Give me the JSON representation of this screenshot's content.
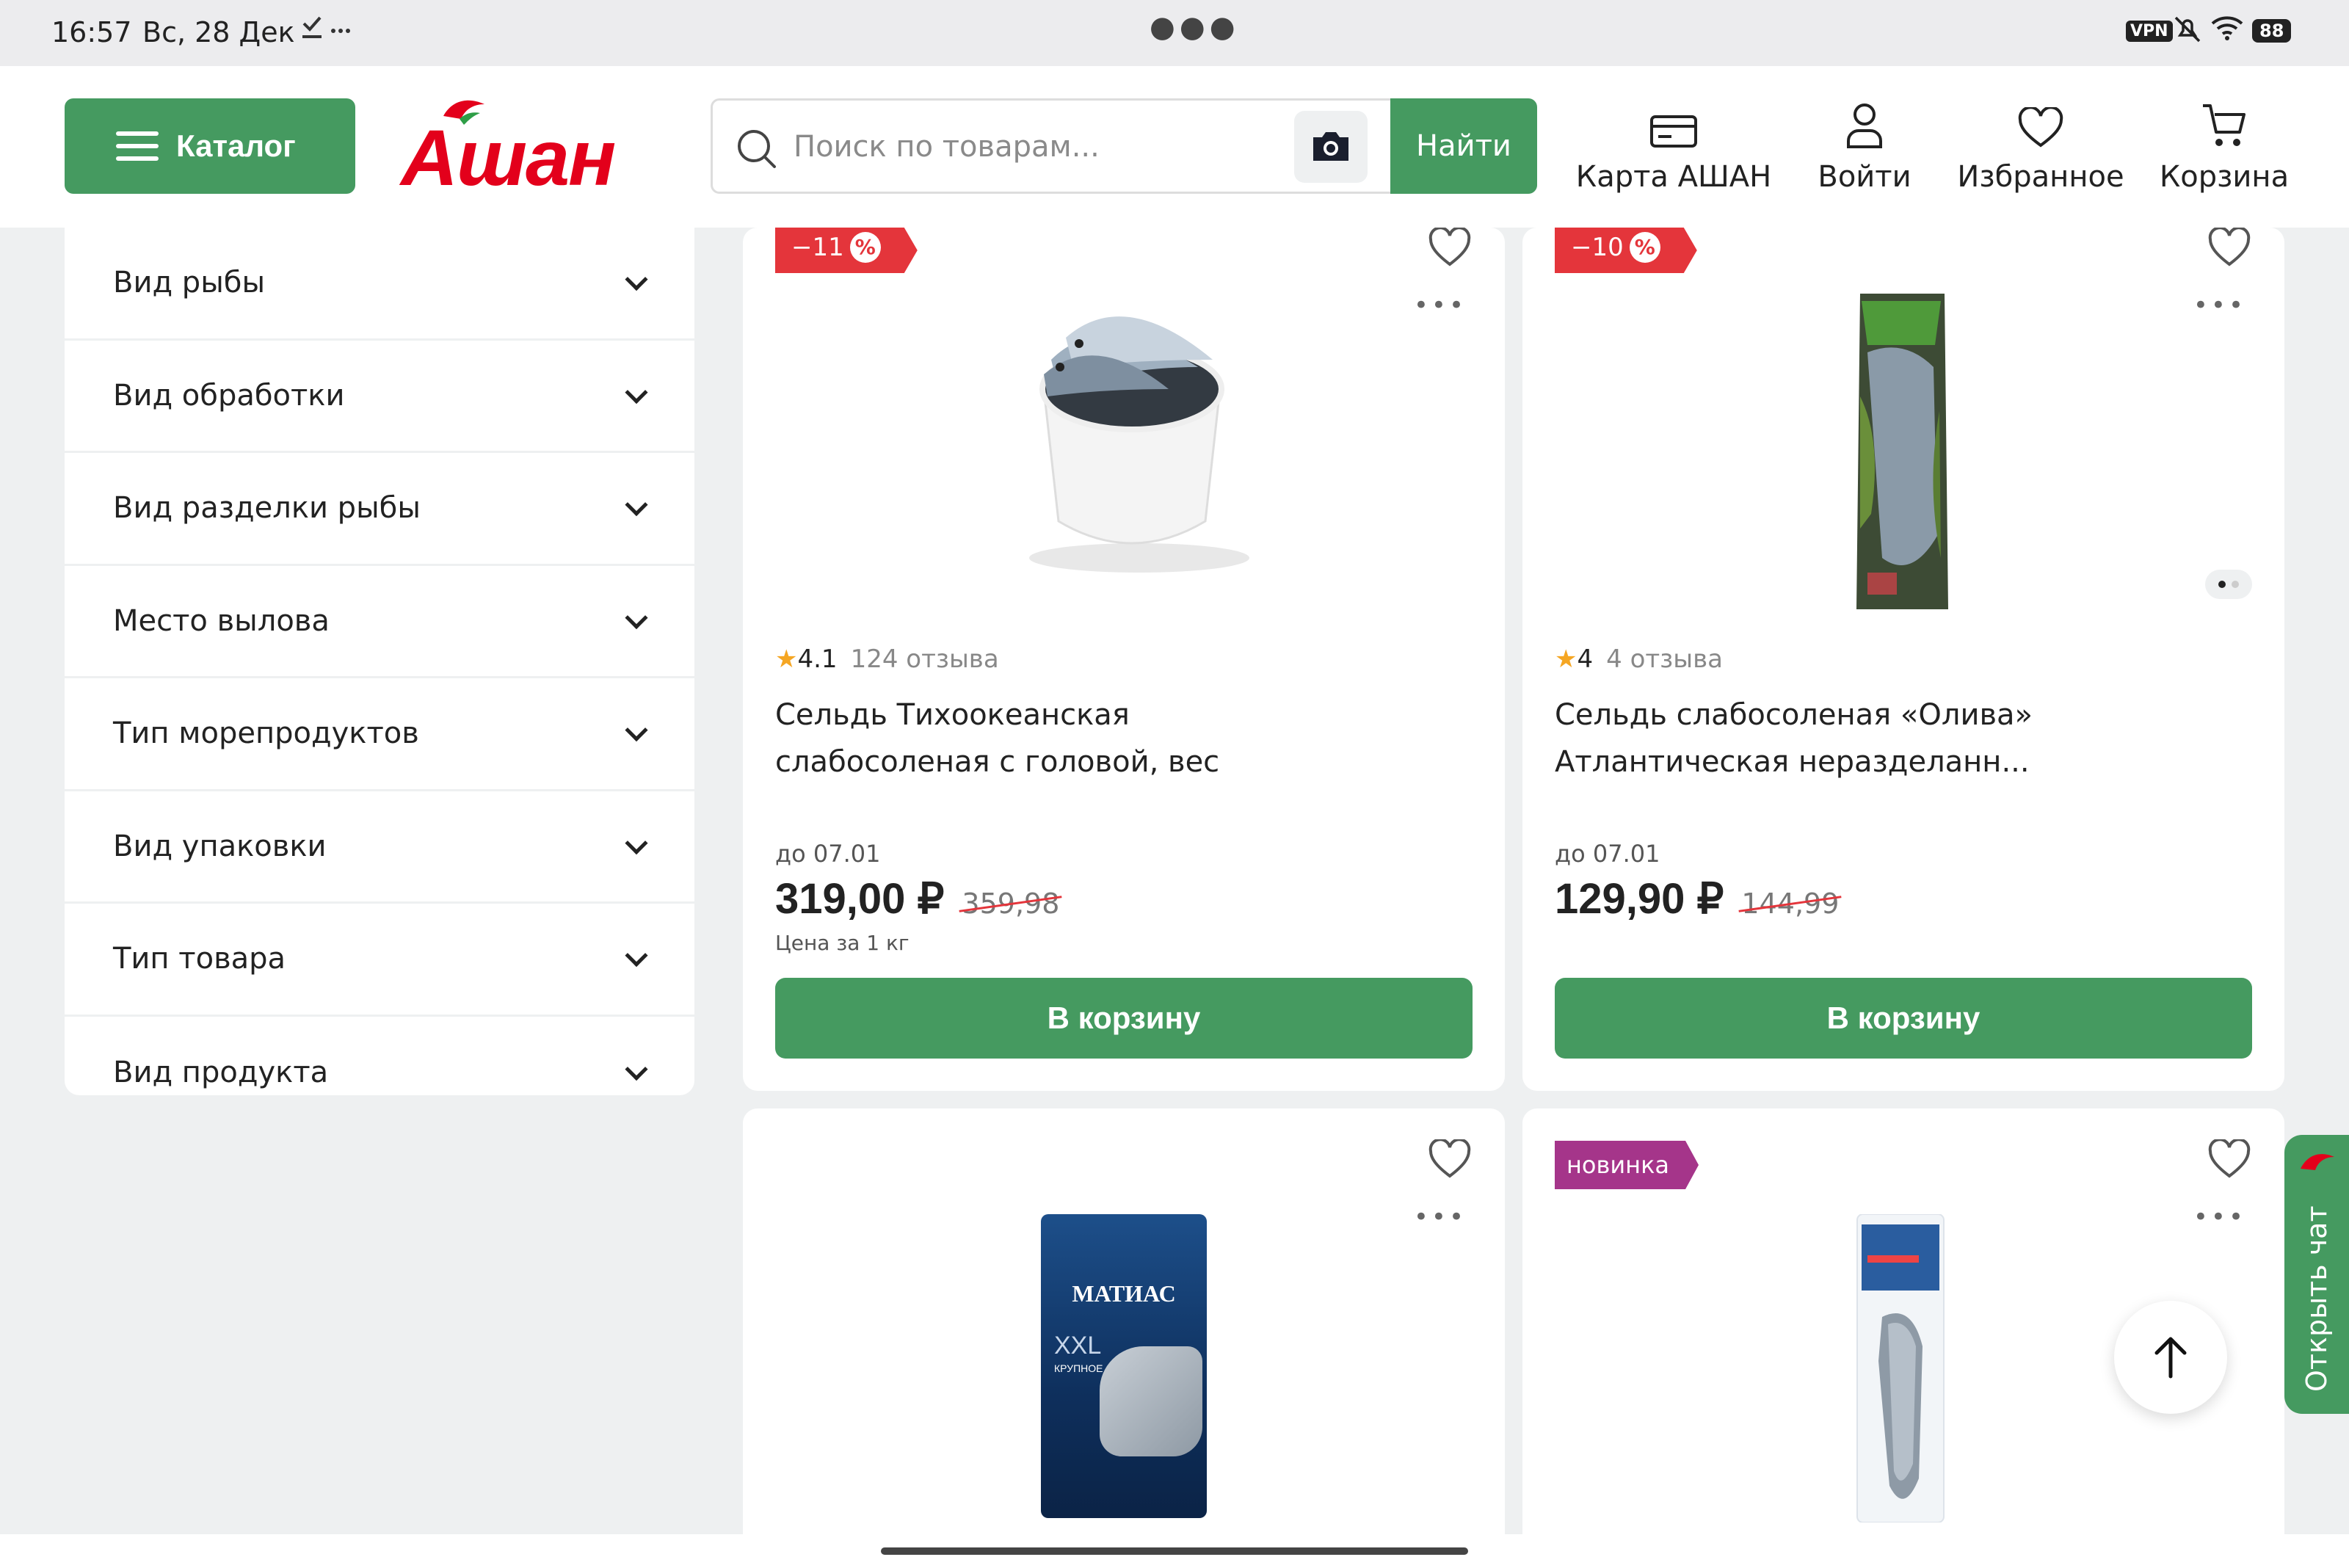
{
  "status_bar": {
    "time": "16:57",
    "date": "Вс, 28 Дек",
    "vpn": "VPN",
    "battery": "88"
  },
  "header": {
    "catalog_label": "Каталог",
    "logo_text": "Ашан",
    "search_placeholder": "Поиск по товарам...",
    "find_label": "Найти",
    "nav": [
      {
        "label": "Карта АШАН",
        "icon": "card-icon"
      },
      {
        "label": "Войти",
        "icon": "user-icon"
      },
      {
        "label": "Избранное",
        "icon": "heart-icon"
      },
      {
        "label": "Корзина",
        "icon": "cart-icon"
      }
    ]
  },
  "filters": [
    {
      "label": "Вид рыбы"
    },
    {
      "label": "Вид обработки"
    },
    {
      "label": "Вид разделки рыбы"
    },
    {
      "label": "Место вылова"
    },
    {
      "label": "Тип морепродуктов"
    },
    {
      "label": "Вид упаковки"
    },
    {
      "label": "Тип товара"
    },
    {
      "label": "Вид продукта"
    }
  ],
  "products": [
    {
      "discount": "−11",
      "discount_symbol": "%",
      "rating": "4.1",
      "reviews": "124 отзыва",
      "name_line1": "Сельдь Тихоокеанская",
      "name_line2": "слабосоленая с головой, вес",
      "until": "до 07.01",
      "price": "319,00 ₽",
      "old_price": "359,98",
      "unit": "Цена за 1 кг",
      "cart_label": "В корзину"
    },
    {
      "discount": "−10",
      "discount_symbol": "%",
      "rating": "4",
      "reviews": "4 отзыва",
      "name_line1": "Сельдь слабосоленая «Олива»",
      "name_line2": "Атлантическая неразделанн...",
      "until": "до 07.01",
      "price": "129,90 ₽",
      "old_price": "144,99",
      "cart_label": "В корзину"
    },
    {
      "image_label": "МАТИАС",
      "image_sub": "XXL",
      "image_sub2": "КРУПНОЕ"
    },
    {
      "badge": "новинка"
    }
  ],
  "chat_label": "Открыть чат",
  "colors": {
    "brand_green": "#459a60",
    "brand_red": "#e3001b",
    "discount_red": "#e4353b",
    "new_badge": "#a5358a",
    "rating_star": "#f5a623"
  }
}
